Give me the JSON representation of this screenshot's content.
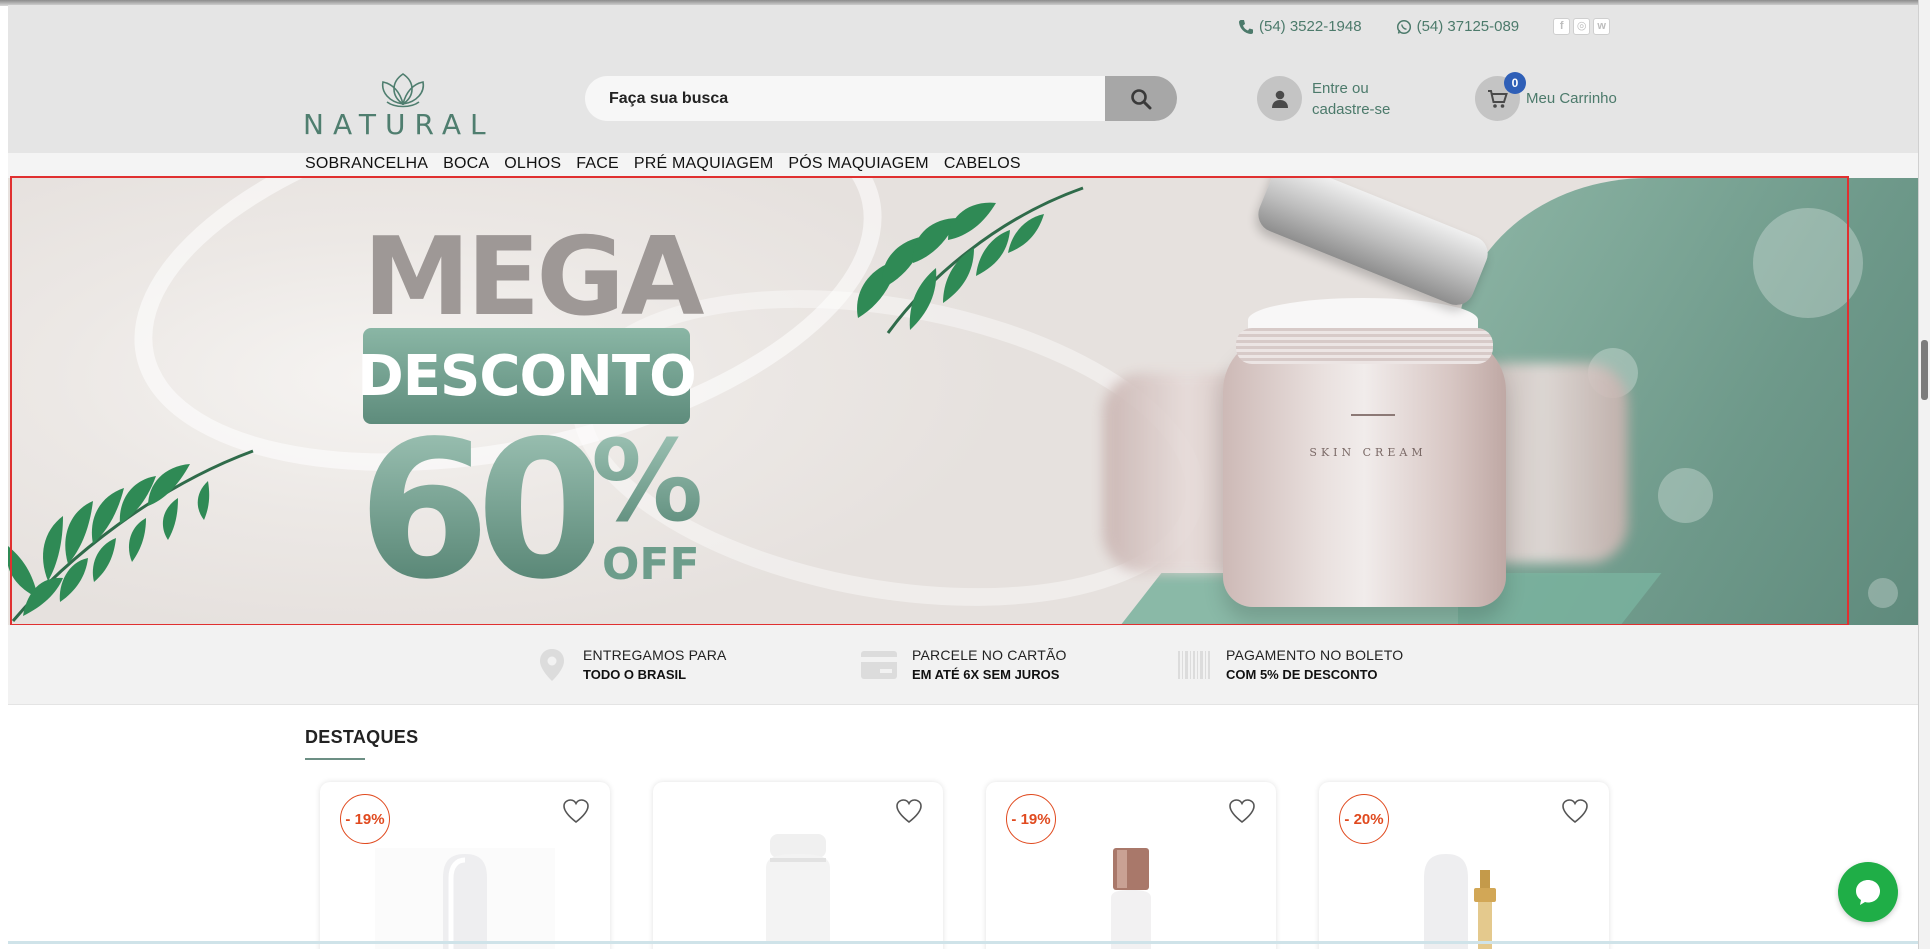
{
  "header": {
    "phone": "(54) 3522-1948",
    "whatsapp": "(54) 37125-089",
    "social_icons": [
      "facebook-icon",
      "instagram-icon",
      "wordpress-icon"
    ],
    "logo_text": "NATURAL",
    "search": {
      "placeholder": "Faça sua busca"
    },
    "account_label_line1": "Entre ou",
    "account_label_line2": "cadastre-se",
    "cart_count": "0",
    "cart_label": "Meu Carrinho"
  },
  "nav": {
    "items": [
      "SOBRANCELHA",
      "BOCA",
      "OLHOS",
      "FACE",
      "PRÉ MAQUIAGEM",
      "PÓS MAQUIAGEM",
      "CABELOS"
    ]
  },
  "banner": {
    "line1": "MEGA",
    "line2": "DESCONTO",
    "number": "60",
    "percent": "%",
    "off": "OFF",
    "product_label": "SKIN CREAM"
  },
  "features": [
    {
      "line1": "ENTREGAMOS PARA",
      "line2": "TODO O BRASIL",
      "icon": "location-pin-icon"
    },
    {
      "line1": "PARCELE NO CARTÃO",
      "line2": "EM ATÉ 6X SEM JUROS",
      "icon": "credit-card-icon"
    },
    {
      "line1": "PAGAMENTO NO BOLETO",
      "line2": "COM 5% DE DESCONTO",
      "icon": "barcode-icon"
    }
  ],
  "highlights": {
    "title": "DESTAQUES",
    "products": [
      {
        "discount": "- 19%"
      },
      {
        "discount": ""
      },
      {
        "discount": "- 19%"
      },
      {
        "discount": "- 20%"
      }
    ]
  },
  "colors": {
    "brand_green": "#4f7e6f",
    "discount_red": "#e04a1f",
    "chat_green": "#1fae47",
    "cart_badge_blue": "#2f5fb7"
  }
}
